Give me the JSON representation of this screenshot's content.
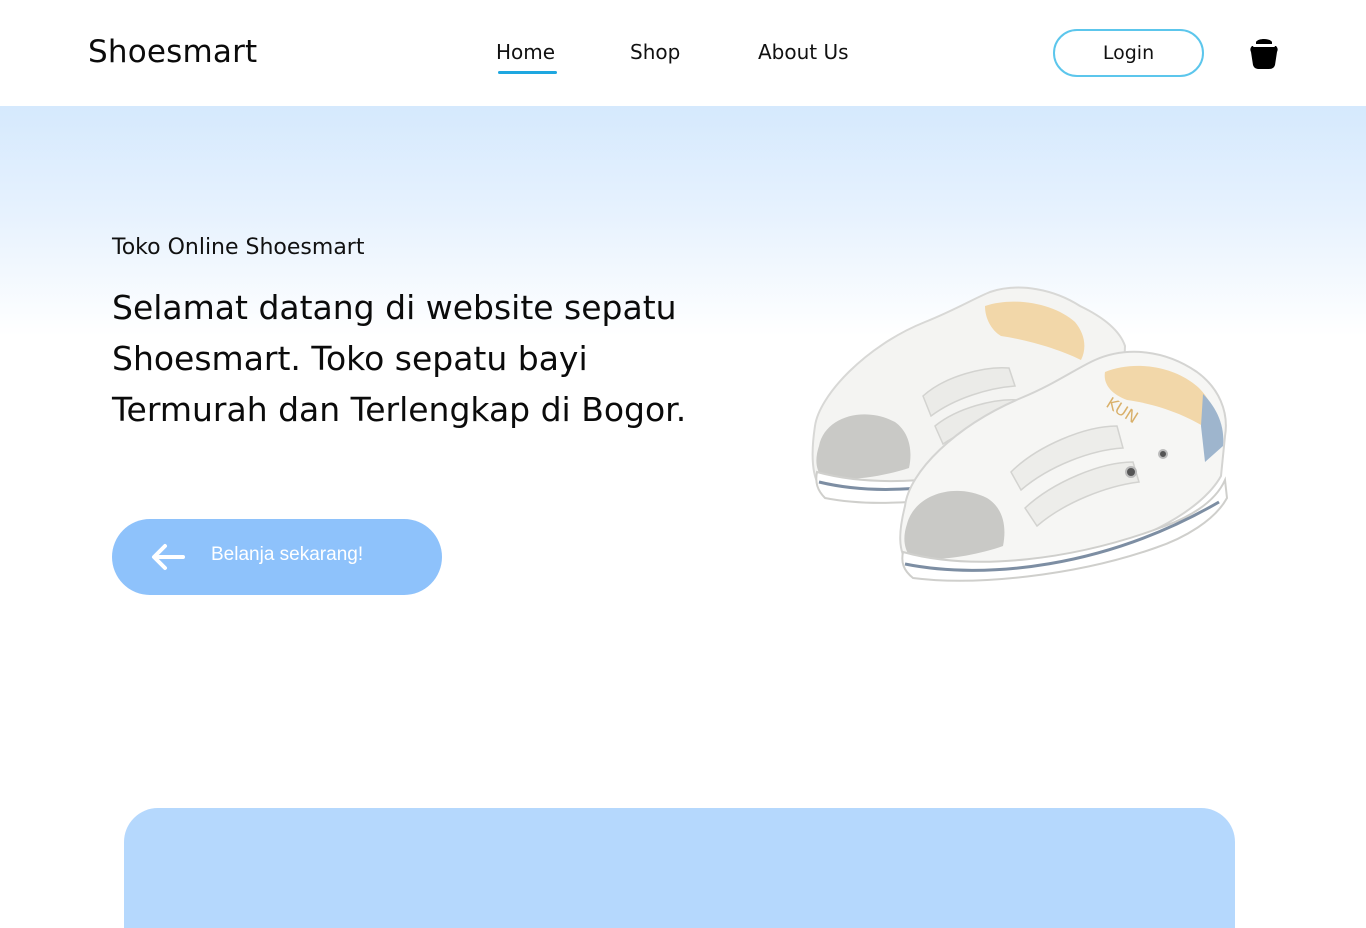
{
  "navbar": {
    "brand": "Shoesmart",
    "links": [
      {
        "label": "Home",
        "active": true
      },
      {
        "label": "Shop",
        "active": false
      },
      {
        "label": "About Us",
        "active": false
      }
    ],
    "login_label": "Login",
    "cart_icon": "shopping-bag-icon"
  },
  "hero": {
    "subtitle": "Toko Online Shoesmart",
    "title": "Selamat datang di website sepatu Shoesmart. Toko sepatu bayi Termurah dan Terlengkap di Bogor.",
    "cta_label": "Belanja sekarang!",
    "cta_icon": "arrow-left-icon",
    "image": "white-baby-sneaker-image"
  },
  "colors": {
    "accent": "#1ea7e0",
    "login_border": "#5cc6ec",
    "cta_background": "#8ec2fb",
    "hero_gradient_top": "#d5e9fd",
    "panel_background": "#b5d8fd"
  }
}
